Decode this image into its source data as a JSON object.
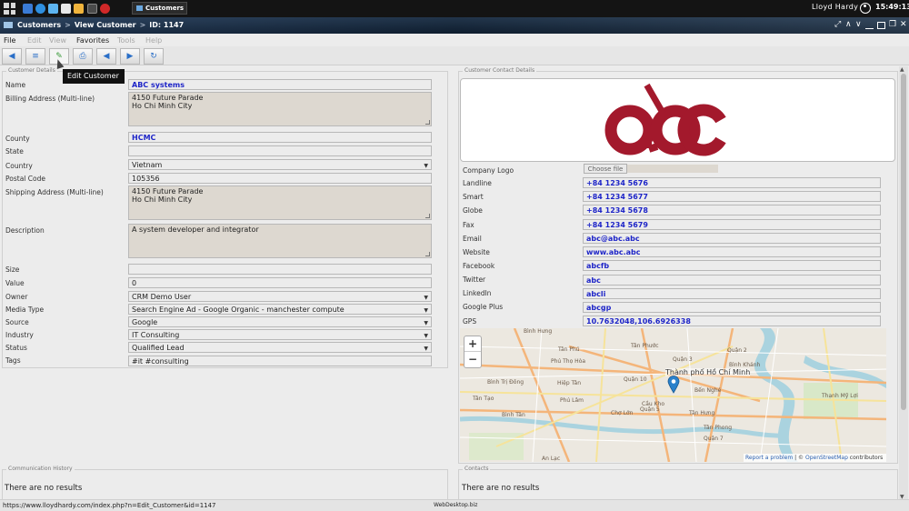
{
  "taskbar": {
    "task_label": "Customers",
    "user_name": "Lloyd Hardy",
    "clock": "15:49:13"
  },
  "window": {
    "breadcrumb": [
      "Customers",
      "View Customer",
      "ID: 1147"
    ]
  },
  "menu": {
    "file": "File",
    "edit": "Edit",
    "view": "View",
    "favorites": "Favorites",
    "tools": "Tools",
    "help": "Help"
  },
  "tooltip": "Edit Customer",
  "customer_details": {
    "legend": "Customer Details",
    "name_label": "Name",
    "name": "ABC systems",
    "billing_label": "Billing Address (Multi-line)",
    "billing": "4150 Future Parade\nHo Chi Minh City",
    "county_label": "County",
    "county": "HCMC",
    "state_label": "State",
    "state": "",
    "country_label": "Country",
    "country": "Vietnam",
    "postal_label": "Postal Code",
    "postal": "105356",
    "shipping_label": "Shipping Address (Multi-line)",
    "shipping": "4150 Future Parade\nHo Chi Minh City",
    "description_label": "Description",
    "description": "A system developer and integrator",
    "size_label": "Size",
    "size": "",
    "value_label": "Value",
    "value": "0",
    "owner_label": "Owner",
    "owner": "CRM Demo User",
    "media_label": "Media Type",
    "media": "Search Engine Ad - Google Organic - manchester compute",
    "source_label": "Source",
    "source": "Google",
    "industry_label": "Industry",
    "industry": "IT Consulting",
    "status_label": "Status",
    "status": "Qualified Lead",
    "tags_label": "Tags",
    "tags": "#it #consulting"
  },
  "contact_details": {
    "legend": "Customer Contact Details",
    "logo_label": "Company Logo",
    "choose_file": "Choose file",
    "landline_label": "Landline",
    "landline": "+84 1234 5676",
    "smart_label": "Smart",
    "smart": "+84 1234 5677",
    "globe_label": "Globe",
    "globe": "+84 1234 5678",
    "fax_label": "Fax",
    "fax": "+84 1234 5679",
    "email_label": "Email",
    "email": "abc@abc.abc",
    "website_label": "Website",
    "website": "www.abc.abc",
    "facebook_label": "Facebook",
    "facebook": "abcfb",
    "twitter_label": "Twitter",
    "twitter": "abc",
    "linkedin_label": "LinkedIn",
    "linkedin": "abcli",
    "googleplus_label": "Google Plus",
    "googleplus": "abcgp",
    "gps_label": "GPS",
    "gps": "10.7632048,106.6926338"
  },
  "map": {
    "zoom_in": "+",
    "zoom_out": "−",
    "attribution_link": "Report a problem",
    "attribution_sep": " | © ",
    "attribution_osm": "OpenStreetMap",
    "attribution_tail": " contributors",
    "places": [
      "Bình Hưng",
      "Tân Phú",
      "Tân Phước",
      "Phú Thọ Hòa",
      "Bình Trị Đông",
      "Hiệp Tân",
      "Tân Tạo",
      "Bình Tân",
      "Phú Lâm",
      "Quận 10",
      "Quận 5",
      "Quận 3",
      "Thành phố Hồ Chí Minh",
      "Cầu Kho",
      "Quận 2",
      "Bình Khánh",
      "Thạnh Mỹ Lợi",
      "Tân Hưng",
      "Tân Phong",
      "Quận 7",
      "An Lạc",
      "Chợ Lớn",
      "Bến Nghé"
    ]
  },
  "communication": {
    "legend": "Communication History",
    "empty": "There are no results"
  },
  "contacts": {
    "legend": "Contacts",
    "empty": "There are no results"
  },
  "status_bar": {
    "url": "https://www.lloydhardy.com/index.php?n=Edit_Customer&id=1147",
    "brand": "WebDesktop.biz"
  },
  "colors": {
    "link_blue": "#1e25c8",
    "logo_red": "#a3192c",
    "taskbar": "#141414"
  }
}
